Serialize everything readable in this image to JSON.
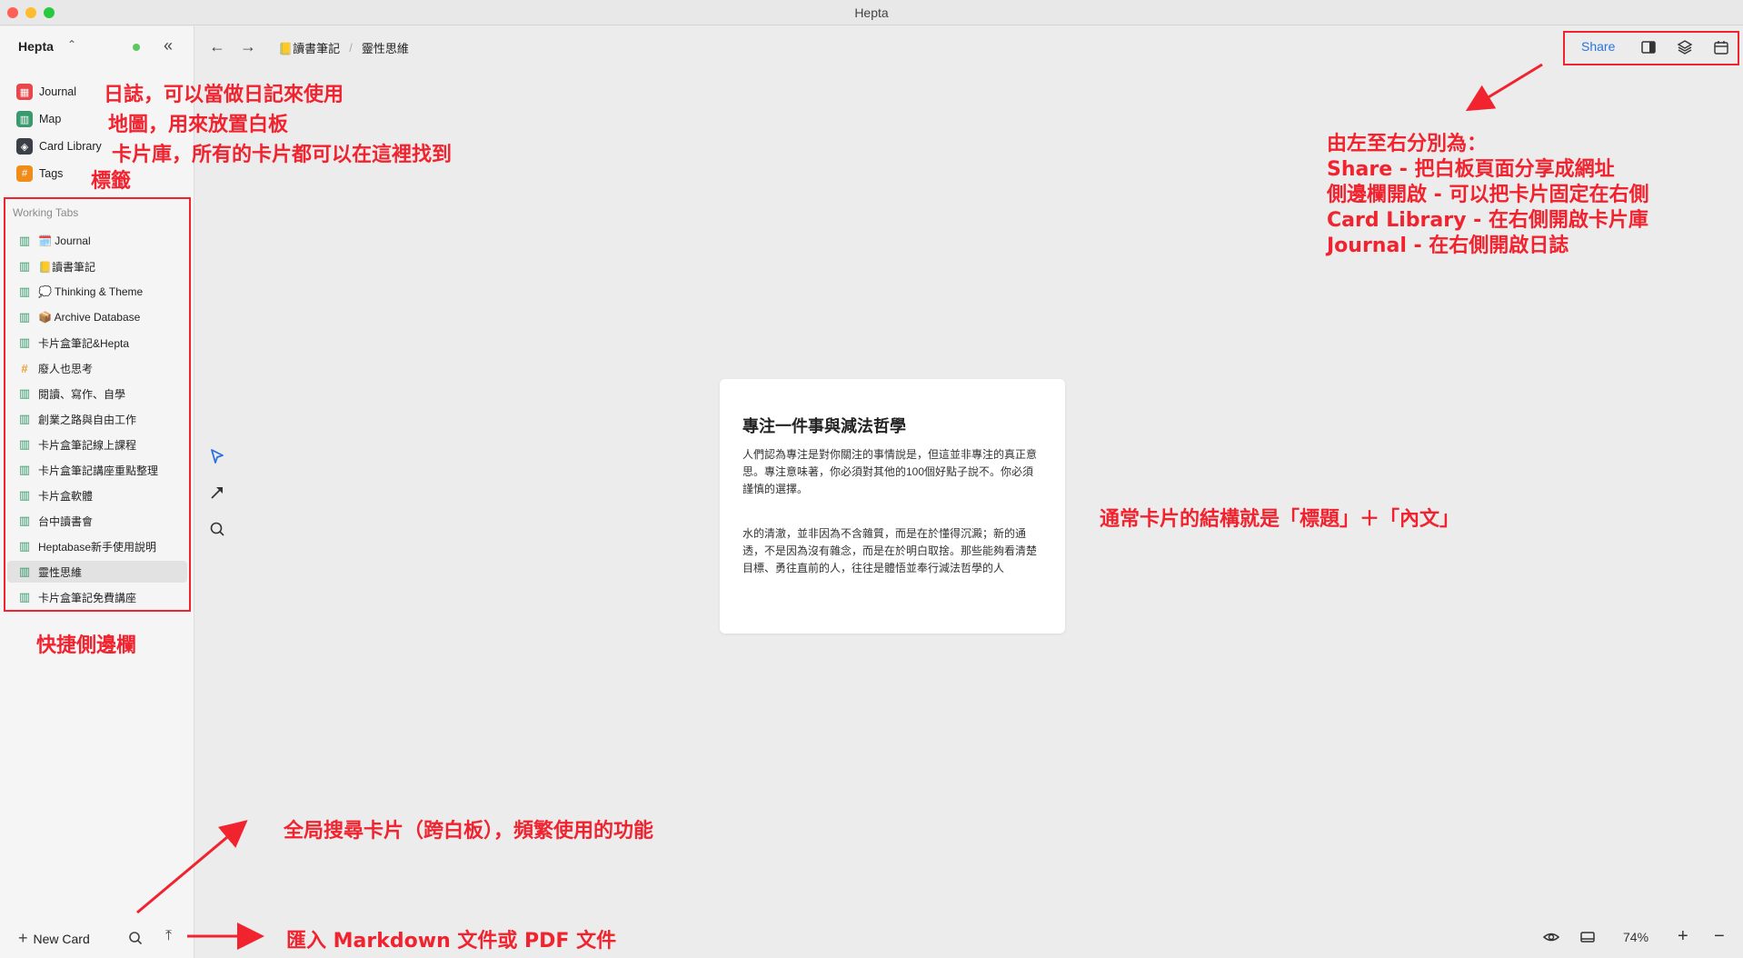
{
  "window": {
    "title": "Hepta"
  },
  "sidebar": {
    "workspace": "Hepta",
    "nav": [
      {
        "label": "Journal",
        "icon": "calendar-icon",
        "color": "#e8484c"
      },
      {
        "label": "Map",
        "icon": "map-icon",
        "color": "#3a9a6e"
      },
      {
        "label": "Card Library",
        "icon": "layers-icon",
        "color": "#3b3f47"
      },
      {
        "label": "Tags",
        "icon": "hash-icon",
        "color": "#f08c1a"
      }
    ],
    "working_tabs_header": "Working Tabs",
    "working_tabs": [
      {
        "label": "🗓️ Journal",
        "icon": "map-icon"
      },
      {
        "label": "📒讀書筆記",
        "icon": "map-icon"
      },
      {
        "label": "💭 Thinking & Theme",
        "icon": "map-icon"
      },
      {
        "label": "📦 Archive Database",
        "icon": "map-icon"
      },
      {
        "label": "卡片盒筆記&Hepta",
        "icon": "map-icon"
      },
      {
        "label": "廢人也思考",
        "icon": "hash-icon"
      },
      {
        "label": "閱讀、寫作、自學",
        "icon": "map-icon"
      },
      {
        "label": "創業之路與自由工作",
        "icon": "map-icon"
      },
      {
        "label": "卡片盒筆記線上課程",
        "icon": "map-icon"
      },
      {
        "label": "卡片盒筆記講座重點整理",
        "icon": "map-icon"
      },
      {
        "label": "卡片盒軟體",
        "icon": "map-icon"
      },
      {
        "label": "台中讀書會",
        "icon": "map-icon"
      },
      {
        "label": "Heptabase新手使用說明",
        "icon": "map-icon"
      },
      {
        "label": "靈性思維",
        "icon": "map-icon",
        "active": true
      },
      {
        "label": "卡片盒筆記免費講座",
        "icon": "map-icon"
      }
    ],
    "new_card": "New Card"
  },
  "breadcrumb": {
    "parent": "📒讀書筆記",
    "current": "靈性思維"
  },
  "toolbar": {
    "share": "Share"
  },
  "card": {
    "title": "專注一件事與減法哲學",
    "p1": "人們認為專注是對你關注的事情說是，但這並非專注的真正意思。專注意味著，你必須對其他的100個好點子說不。你必須謹慎的選擇。",
    "p2": "水的清澈，並非因為不含雜質，而是在於懂得沉澱；新的通透，不是因為沒有雜念，而是在於明白取捨。那些能夠看清楚目標、勇往直前的人，往往是體悟並奉行減法哲學的人"
  },
  "status": {
    "zoom": "74%"
  },
  "annotations": {
    "journal": "日誌，可以當做日記來使用",
    "map": "地圖，用來放置白板",
    "library": "卡片庫，所有的卡片都可以在這裡找到",
    "tags": "標籤",
    "sidebar": "快捷側邊欄",
    "toolbar_title": "由左至右分別為：",
    "toolbar_share": "Share - 把白板頁面分享成網址",
    "toolbar_sidebar": "側邊欄開啟 - 可以把卡片固定在右側",
    "toolbar_library": "Card  Library - 在右側開啟卡片庫",
    "toolbar_journal": "Journal - 在右側開啟日誌",
    "card_structure": "通常卡片的結構就是「標題」＋「內文」",
    "search": "全局搜尋卡片（跨白板），頻繁使用的功能",
    "import": "匯入 Markdown 文件或 PDF 文件"
  },
  "colors": {
    "annotation": "#f0232f",
    "accent": "#2a74e0"
  }
}
